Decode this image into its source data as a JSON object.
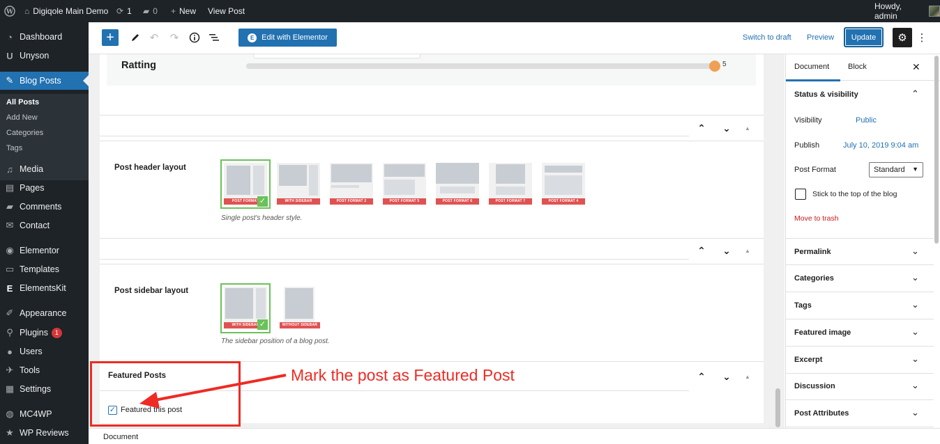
{
  "adminbar": {
    "site_name": "Digiqole Main Demo",
    "updates_count": "1",
    "comments_count": "0",
    "new_label": "New",
    "view_post_label": "View Post",
    "howdy": "Howdy, admin"
  },
  "sidebar": {
    "items": [
      {
        "label": "Dashboard",
        "icon": "gauge-icon"
      },
      {
        "label": "Unyson",
        "icon": "unyson-icon"
      },
      {
        "label": "Blog Posts",
        "icon": "pin-icon"
      },
      {
        "label": "Media",
        "icon": "media-icon"
      },
      {
        "label": "Pages",
        "icon": "page-icon"
      },
      {
        "label": "Comments",
        "icon": "comment-icon"
      },
      {
        "label": "Contact",
        "icon": "mail-icon"
      },
      {
        "label": "Elementor",
        "icon": "elementor-icon"
      },
      {
        "label": "Templates",
        "icon": "folder-icon"
      },
      {
        "label": "ElementsKit",
        "icon": "elementskit-icon"
      },
      {
        "label": "Appearance",
        "icon": "brush-icon"
      },
      {
        "label": "Plugins",
        "icon": "plug-icon",
        "badge": "1"
      },
      {
        "label": "Users",
        "icon": "user-icon"
      },
      {
        "label": "Tools",
        "icon": "wrench-icon"
      },
      {
        "label": "Settings",
        "icon": "settings-icon"
      },
      {
        "label": "MC4WP",
        "icon": "mc4wp-icon"
      },
      {
        "label": "WP Reviews",
        "icon": "star-icon"
      }
    ],
    "submenu": [
      "All Posts",
      "Add New",
      "Categories",
      "Tags"
    ]
  },
  "toolbar": {
    "elementor_label": "Edit with Elementor",
    "switch_draft": "Switch to draft",
    "preview": "Preview",
    "update": "Update"
  },
  "editor": {
    "rating_label": "Ratting",
    "rating_value": "5",
    "rating_fraction": 1.0,
    "header_layout_label": "Post header layout",
    "header_layout_desc": "Single post's header style.",
    "header_layouts": [
      "POST FORMAT",
      "WITH SIDEBAR",
      "POST FORMAT 2",
      "POST FORMAT 5",
      "POST FORMAT 6",
      "POST FORMAT 7",
      "POST FORMAT 4"
    ],
    "sidebar_layout_label": "Post sidebar layout",
    "sidebar_layout_desc": "The sidebar position of a blog post.",
    "sidebar_layouts": [
      "WITH SIDEBAR",
      "WITHOUT SIDEBAR"
    ],
    "featured_title": "Featured Posts",
    "featured_checkbox_label": "Featured this post",
    "featured_checked": true
  },
  "annotation": {
    "text": "Mark the post as Featured Post",
    "color": "#ee2b24"
  },
  "settings": {
    "tab_document": "Document",
    "tab_block": "Block",
    "status_title": "Status & visibility",
    "visibility_label": "Visibility",
    "visibility_value": "Public",
    "publish_label": "Publish",
    "publish_value": "July 10, 2019 9:04 am",
    "format_label": "Post Format",
    "format_value": "Standard",
    "stick_label": "Stick to the top of the blog",
    "trash_label": "Move to trash",
    "sections": [
      "Permalink",
      "Categories",
      "Tags",
      "Featured image",
      "Excerpt",
      "Discussion",
      "Post Attributes"
    ]
  },
  "footer": {
    "breadcrumb": "Document"
  },
  "colors": {
    "accent": "#2271b1",
    "admin_dark": "#1d2327",
    "selected_green": "#6ac259",
    "tag_red": "#e05252"
  }
}
